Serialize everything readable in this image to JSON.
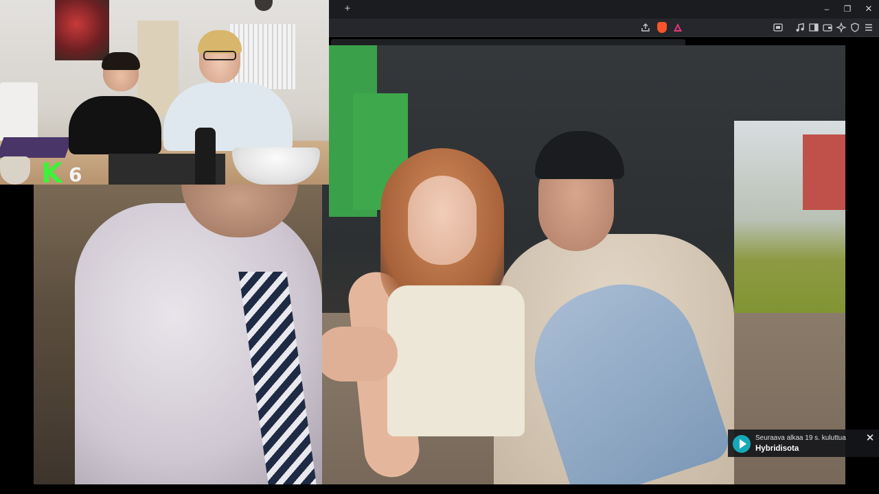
{
  "browser": {
    "new_tab_symbol": "+",
    "window_controls": {
      "minimize_symbol": "–",
      "maximize_symbol": "❐",
      "close_symbol": "✕"
    },
    "toolbar_icons": [
      "share-icon",
      "brave-shield-icon",
      "brave-rewards-icon",
      "screenshot-icon",
      "media-icon",
      "sidebar-icon",
      "wallet-icon",
      "leo-ai-icon",
      "vpn-icon",
      "menu-icon"
    ],
    "accent_color": "#fb542b"
  },
  "webcam": {
    "channel_logo_letter": "K",
    "channel_logo_number": "6",
    "logo_color": "#3df23a"
  },
  "player": {
    "next_episode": {
      "countdown_text": "Seuraava alkaa 19 s. kuluttua",
      "title": "Hybridisota",
      "close_symbol": "✕",
      "play_color": "#16a9b9"
    }
  }
}
